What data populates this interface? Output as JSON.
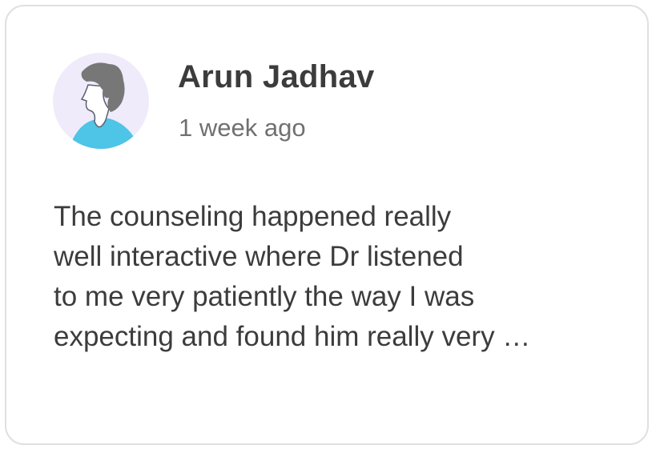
{
  "review": {
    "author": "Arun Jadhav",
    "time": "1 week ago",
    "lines": [
      "The counseling happened really",
      "well interactive where Dr listened",
      "to me very patiently the way I was",
      "expecting and found him really very …"
    ],
    "avatar_icon": "user-avatar-icon"
  },
  "colors": {
    "avatar_bg": "#efebfb",
    "shirt": "#4ec4e6",
    "hair": "#777777"
  }
}
